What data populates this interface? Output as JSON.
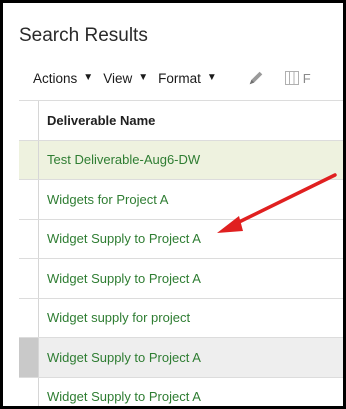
{
  "panel": {
    "title": "Search Results"
  },
  "toolbar": {
    "actions": "Actions",
    "view": "View",
    "format": "Format",
    "cut_off_text": "F"
  },
  "table": {
    "header": "Deliverable Name",
    "rows": [
      "Test Deliverable-Aug6-DW",
      "Widgets for Project A",
      "Widget Supply to Project A",
      "Widget Supply to Project A",
      "Widget supply for project",
      "Widget Supply to Project A",
      "Widget Supply to Project A"
    ]
  },
  "icons": {
    "caret": "caret-down-icon",
    "edit": "pencil-icon",
    "columns": "columns-icon"
  },
  "colors": {
    "link": "#2e7d32",
    "highlight_row": "#eef2df",
    "selected_row": "#eeeeee",
    "annotation_arrow": "#e02020"
  }
}
